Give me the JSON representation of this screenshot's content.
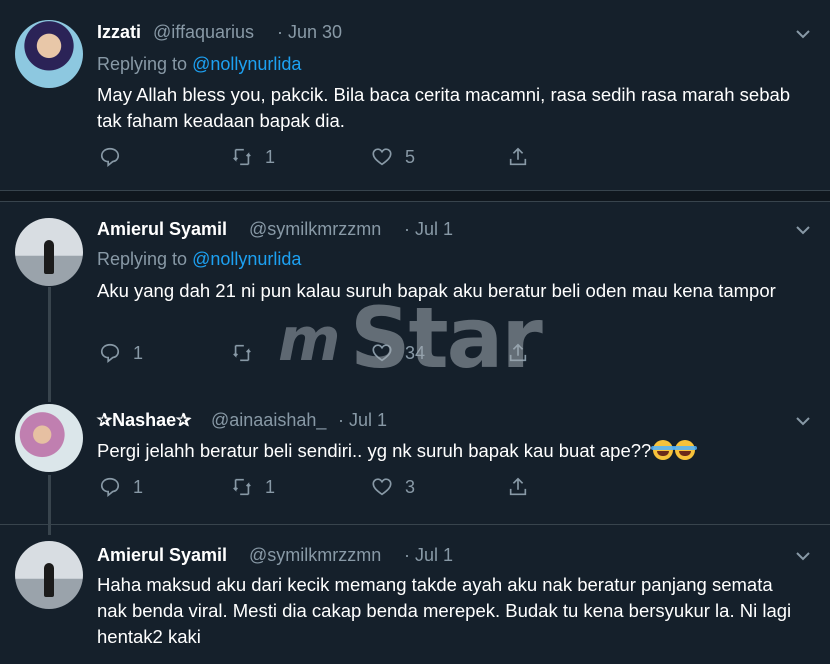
{
  "tweets": [
    {
      "name": "Izzati",
      "handle": "@iffaquarius",
      "date": "· Jun 30",
      "replying_prefix": "Replying to ",
      "replying_to": "@nollynurlida",
      "text": "May Allah bless you, pakcik. Bila baca cerita macamni, rasa sedih rasa marah sebab tak faham keadaan bapak dia.",
      "reply_count": "",
      "retweet_count": "1",
      "like_count": "5"
    },
    {
      "name": "Amierul Syamil",
      "handle": "@symilkmrzzmn",
      "date": "· Jul 1",
      "replying_prefix": "Replying to ",
      "replying_to": "@nollynurlida",
      "text": "Aku yang dah 21 ni pun kalau suruh bapak aku beratur beli oden mau kena tampor",
      "reply_count": "1",
      "retweet_count": "",
      "like_count": "34"
    },
    {
      "name": "✰Nashae✰",
      "handle": "@ainaaishah_",
      "date": "· Jul 1",
      "text": "Pergi jelahh beratur beli sendiri.. yg nk suruh bapak kau buat ape??",
      "reply_count": "1",
      "retweet_count": "1",
      "like_count": "3"
    },
    {
      "name": "Amierul Syamil",
      "handle": "@symilkmrzzmn",
      "date": "· Jul 1",
      "text": "Haha maksud aku dari kecik memang takde ayah aku nak beratur panjang semata nak benda viral. Mesti dia cakap benda merepek. Budak tu kena bersyukur la. Ni lagi hentak2 kaki"
    }
  ],
  "icons": {
    "reply": "reply-icon",
    "retweet": "retweet-icon",
    "like": "heart-icon",
    "share": "share-icon",
    "more": "chevron-down-icon"
  },
  "watermark": {
    "prefix": "m",
    "word": "Star"
  },
  "colors": {
    "background": "#15202b",
    "muted": "#8899a6",
    "link": "#1da1f2",
    "divider": "#38444d"
  }
}
